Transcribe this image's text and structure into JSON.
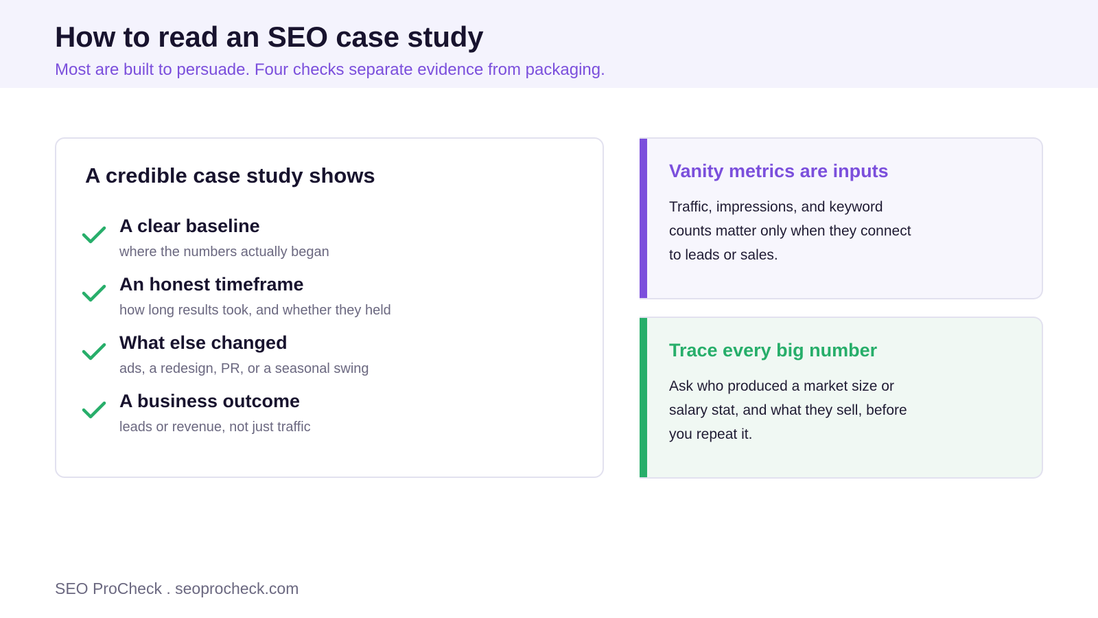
{
  "header": {
    "title": "How to read an SEO case study",
    "subtitle": "Most are built to persuade. Four checks separate evidence from packaging."
  },
  "checklist": {
    "title": "A credible case study shows",
    "icon": "checkmark-icon",
    "icon_color": "#27ae6a",
    "items": [
      {
        "title": "A clear baseline",
        "subtitle": "where the numbers actually began"
      },
      {
        "title": "An honest timeframe",
        "subtitle": "how long results took, and whether they held"
      },
      {
        "title": "What else changed",
        "subtitle": "ads, a redesign, PR, or a seasonal swing"
      },
      {
        "title": "A business outcome",
        "subtitle": "leads or revenue, not just traffic"
      }
    ]
  },
  "callouts": [
    {
      "title": "Vanity metrics are inputs",
      "body": "Traffic, impressions, and keyword counts matter only when they connect to leads or sales.",
      "accent_color": "#7b4fdc"
    },
    {
      "title": "Trace every big number",
      "body": "Ask who produced a market size or salary stat, and what they sell, before you repeat it.",
      "accent_color": "#27ae6a"
    }
  ],
  "footer": {
    "text": "SEO ProCheck . seoprocheck.com"
  },
  "colors": {
    "header_background": "#f4f3fd",
    "brand_purple": "#7b4fdc",
    "success_green": "#27ae6a",
    "heading_text": "#18132e",
    "muted_text": "#6b6880"
  }
}
